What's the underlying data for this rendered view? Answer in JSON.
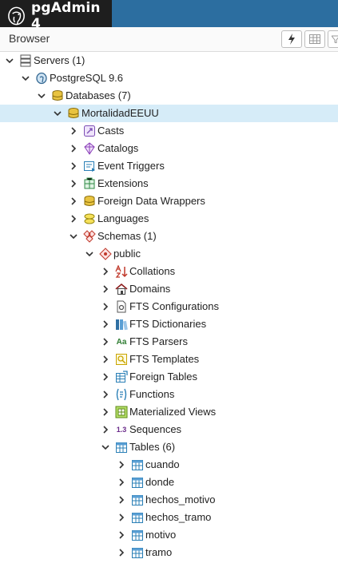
{
  "app": {
    "title": "pgAdmin 4"
  },
  "panel": {
    "title": "Browser"
  },
  "tree": {
    "servers": "Servers (1)",
    "postgres": "PostgreSQL 9.6",
    "databases": "Databases (7)",
    "db": "MortalidadEEUU",
    "casts": "Casts",
    "catalogs": "Catalogs",
    "event_triggers": "Event Triggers",
    "extensions": "Extensions",
    "fdw": "Foreign Data Wrappers",
    "languages": "Languages",
    "schemas": "Schemas (1)",
    "public": "public",
    "collations": "Collations",
    "domains": "Domains",
    "fts_configurations": "FTS Configurations",
    "fts_dictionaries": "FTS Dictionaries",
    "fts_parsers": "FTS Parsers",
    "fts_templates": "FTS Templates",
    "foreign_tables": "Foreign Tables",
    "functions": "Functions",
    "materialized_views": "Materialized Views",
    "sequences": "Sequences",
    "tables": "Tables (6)",
    "table_cuando": "cuando",
    "table_donde": "donde",
    "table_hechos_motivo": "hechos_motivo",
    "table_hechos_tramo": "hechos_tramo",
    "table_motivo": "motivo",
    "table_tramo": "tramo"
  },
  "icon_glyphs": {
    "fts_parsers": "Aa",
    "sequences": "1.3"
  },
  "colors": {
    "topbar": "#2c6ea0",
    "brand_bg": "#1e1e1e",
    "selected_row": "#d6ecf8"
  }
}
